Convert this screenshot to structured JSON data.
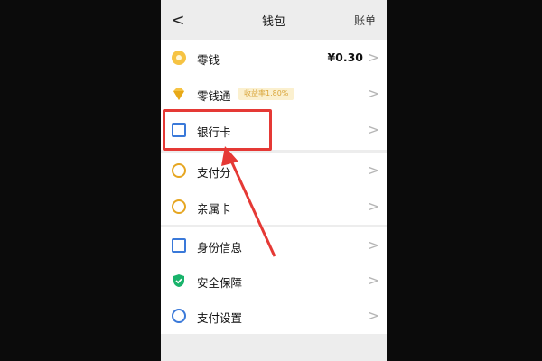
{
  "header": {
    "back_glyph": "<",
    "title": "钱包",
    "bill_label": "账单"
  },
  "menu": {
    "change": {
      "label": "零钱",
      "value": "¥0.30",
      "chevron": ">"
    },
    "change_pass": {
      "label": "零钱通",
      "badge": "收益率1.80%",
      "chevron": ">"
    },
    "bank_card": {
      "label": "银行卡",
      "chevron": ">"
    },
    "pay_score": {
      "label": "支付分",
      "chevron": ">"
    },
    "family_card": {
      "label": "亲属卡",
      "chevron": ">"
    },
    "identity": {
      "label": "身份信息",
      "chevron": ">"
    },
    "security": {
      "label": "安全保障",
      "chevron": ">"
    },
    "pay_settings": {
      "label": "支付设置",
      "chevron": ">"
    }
  },
  "annotation": {
    "highlight_color": "#e53935"
  },
  "icons": {
    "change": "coin-icon",
    "change_pass": "diamond-icon",
    "bank_card": "bank-card-icon",
    "pay_score": "pay-score-icon",
    "family_card": "family-card-icon",
    "identity": "id-card-icon",
    "security": "shield-icon",
    "pay_settings": "settings-gear-icon"
  }
}
